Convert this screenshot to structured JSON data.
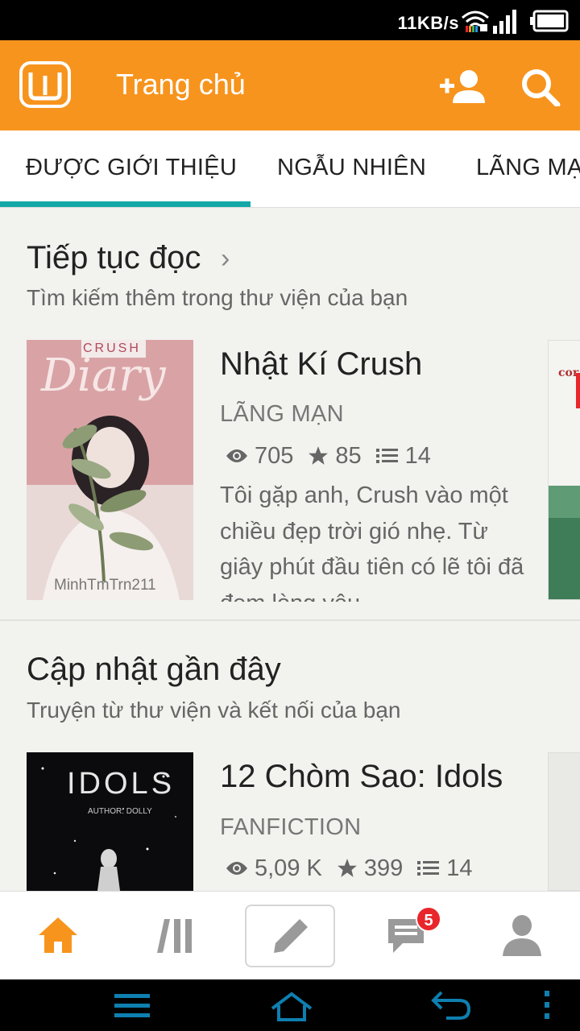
{
  "status_bar": {
    "net_speed": "11KB/s",
    "icons": [
      "wifi-icon",
      "signal-icon",
      "battery-icon"
    ]
  },
  "app_bar": {
    "title": "Trang chủ",
    "icons": [
      "wattpad-logo-icon",
      "add-user-icon",
      "search-icon"
    ]
  },
  "tabs": [
    {
      "label": "ĐƯỢC GIỚI THIỆU",
      "active": true
    },
    {
      "label": "NGẪU NHIÊN",
      "active": false
    },
    {
      "label": "LÃNG MẠN",
      "active": false
    }
  ],
  "sections": [
    {
      "title": "Tiếp tục đọc",
      "subtitle": "Tìm kiếm thêm trong thư viện của bạn",
      "stories": [
        {
          "cover_text": {
            "top": "CRUSH",
            "script": "Diary",
            "author": "MinhTmTrn211"
          },
          "title": "Nhật Kí Crush",
          "genre": "LÃNG MẠN",
          "reads": "705",
          "votes": "85",
          "parts": "14",
          "description": "Tôi gặp anh, Crush vào một chiều đẹp trời gió nhẹ. Từ giây phút đầu tiên có lẽ tôi đã đem lòng yêu"
        }
      ],
      "next_cover_text": "cor"
    },
    {
      "title": "Cập nhật gần đây",
      "subtitle": "Truyện từ thư viện và kết nối của bạn",
      "stories": [
        {
          "cover_text": {
            "title": "IDOLS",
            "author": "AUTHOR: DOLLY"
          },
          "title": "12 Chòm Sao: Idols",
          "genre": "FANFICTION",
          "reads": "5,09 K",
          "votes": "399",
          "parts": "14"
        }
      ]
    }
  ],
  "bottom_nav": {
    "items": [
      "home-icon",
      "library-icon",
      "write-icon",
      "messages-icon",
      "profile-icon"
    ],
    "messages_badge": "5",
    "active_color": "#f7941d",
    "inactive_color": "#9a9a9a"
  },
  "colors": {
    "accent": "#f7941d",
    "tab_indicator": "#13a8a8"
  }
}
